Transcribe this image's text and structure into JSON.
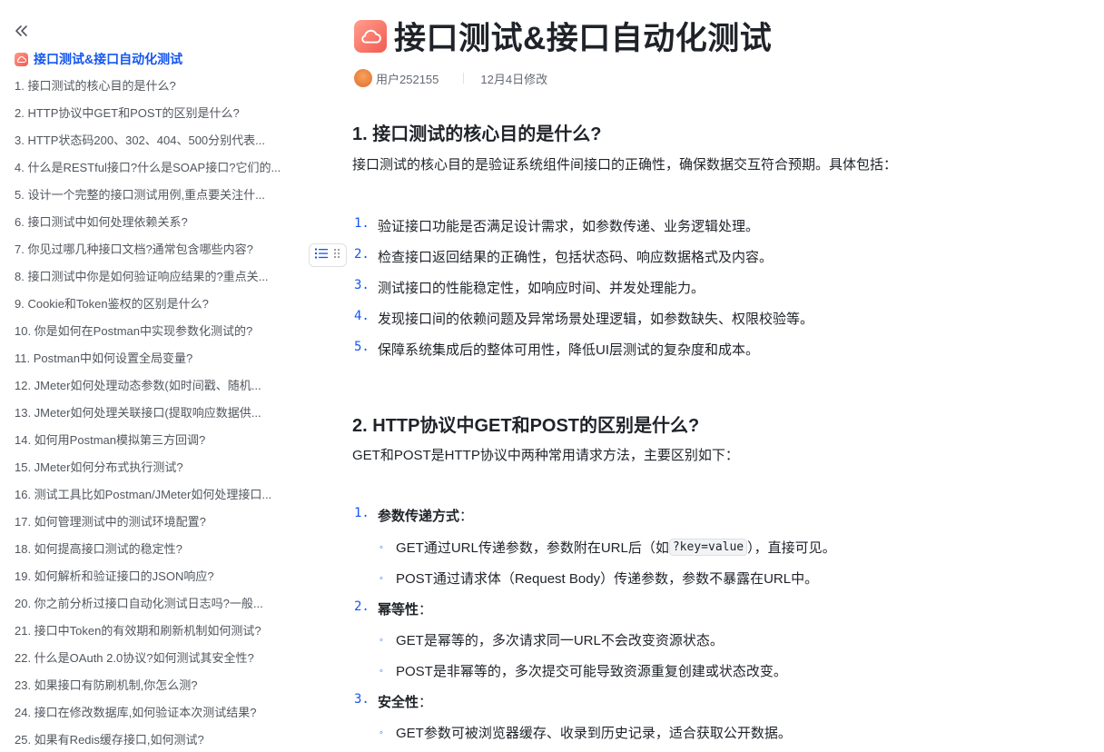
{
  "sidebar": {
    "toc_title": "接口测试&接口自动化测试",
    "items": [
      "1. 接口测试的核心目的是什么?",
      "2. HTTP协议中GET和POST的区别是什么?",
      "3. HTTP状态码200、302、404、500分别代表...",
      "4. 什么是RESTful接口?什么是SOAP接口?它们的...",
      "5. 设计一个完整的接口测试用例,重点要关注什...",
      "6. 接口测试中如何处理依赖关系?",
      "7. 你见过哪几种接口文档?通常包含哪些内容?",
      "8. 接口测试中你是如何验证响应结果的?重点关...",
      "9. Cookie和Token鉴权的区别是什么?",
      "10. 你是如何在Postman中实现参数化测试的?",
      "11. Postman中如何设置全局变量?",
      "12. JMeter如何处理动态参数(如时间戳、随机...",
      "13. JMeter如何处理关联接口(提取响应数据供...",
      "14. 如何用Postman模拟第三方回调?",
      "15. JMeter如何分布式执行测试?",
      "16. 测试工具比如Postman/JMeter如何处理接口...",
      "17. 如何管理测试中的测试环境配置?",
      "18. 如何提高接口测试的稳定性?",
      "19. 如何解析和验证接口的JSON响应?",
      "20. 你之前分析过接口自动化测试日志吗?一般...",
      "21. 接口中Token的有效期和刷新机制如何测试?",
      "22. 什么是OAuth 2.0协议?如何测试其安全性?",
      "23. 如果接口有防刷机制,你怎么测?",
      "24. 接口在修改数据库,如何验证本次测试结果?",
      "25. 如果有Redis缓存接口,如何测试?"
    ]
  },
  "doc": {
    "title": "接口测试&接口自动化测试",
    "author": "用户252155",
    "modified": "12月4日修改"
  },
  "section1": {
    "heading": "1. 接口测试的核心目的是什么?",
    "intro": "接口测试的核心目的是验证系统组件间接口的正确性，确保数据交互符合预期。具体包括：",
    "items": [
      "验证接口功能是否满足设计需求，如参数传递、业务逻辑处理。",
      "检查接口返回结果的正确性，包括状态码、响应数据格式及内容。",
      "测试接口的性能稳定性，如响应时间、并发处理能力。",
      "发现接口间的依赖问题及异常场景处理逻辑，如参数缺失、权限校验等。",
      "保障系统集成后的整体可用性，降低UI层测试的复杂度和成本。"
    ]
  },
  "section2": {
    "heading": "2. HTTP协议中GET和POST的区别是什么?",
    "intro": "GET和POST是HTTP协议中两种常用请求方法，主要区别如下：",
    "p1_label": "参数传递方式",
    "p1_b1_pre": "GET通过URL传递参数，参数附在URL后（如 ",
    "p1_b1_code": "?key=value",
    "p1_b1_post": " ），直接可见。",
    "p1_b2": "POST通过请求体（Request Body）传递参数，参数不暴露在URL中。",
    "p2_label": "幂等性",
    "p2_b1": "GET是幂等的，多次请求同一URL不会改变资源状态。",
    "p2_b2": "POST是非幂等的，多次提交可能导致资源重复创建或状态改变。",
    "p3_label": "安全性",
    "p3_b1": "GET参数可被浏览器缓存、收录到历史记录，适合获取公开数据。",
    "colon": "："
  },
  "numbers": [
    "1.",
    "2.",
    "3.",
    "4.",
    "5."
  ],
  "bullet": "◦",
  "colors": {
    "accent": "#1456f0",
    "icon_red": "#f25a4f",
    "text": "#1f2329",
    "muted": "#646a73"
  },
  "icons": {
    "collapse": "double-chevron-left-icon",
    "doc": "cloud-doc-icon",
    "list": "list-icon",
    "drag": "drag-handle-icon"
  }
}
